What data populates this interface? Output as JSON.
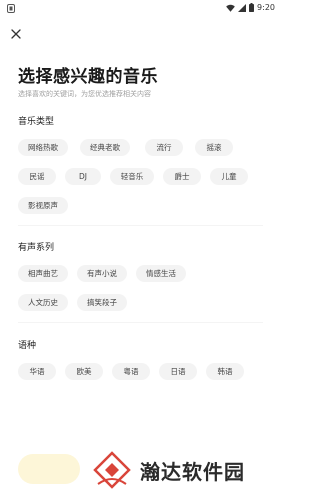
{
  "status_bar": {
    "time": "9:20"
  },
  "header": {
    "title": "选择感兴趣的音乐",
    "subtitle": "选择喜欢的关键词，为您优选推荐相关内容"
  },
  "sections": [
    {
      "title": "音乐类型",
      "rows": [
        [
          "网络热歌",
          "经典老歌",
          "流行",
          "摇滚"
        ],
        [
          "民谣",
          "DJ",
          "轻音乐",
          "爵士",
          "儿童"
        ],
        [
          "影视原声"
        ]
      ]
    },
    {
      "title": "有声系列",
      "rows": [
        [
          "相声曲艺",
          "有声小说",
          "情感生活"
        ],
        [
          "人文历史",
          "搞笑段子"
        ]
      ]
    },
    {
      "title": "语种",
      "rows": [
        [
          "华语",
          "欧美",
          "粤语",
          "日语",
          "韩语"
        ]
      ]
    }
  ],
  "watermark": {
    "text": "瀚达软件园"
  },
  "colors": {
    "tag_bg": "#f3f3f3",
    "confirm_bg": "#fdf6d8",
    "watermark_red": "#d9453a"
  }
}
